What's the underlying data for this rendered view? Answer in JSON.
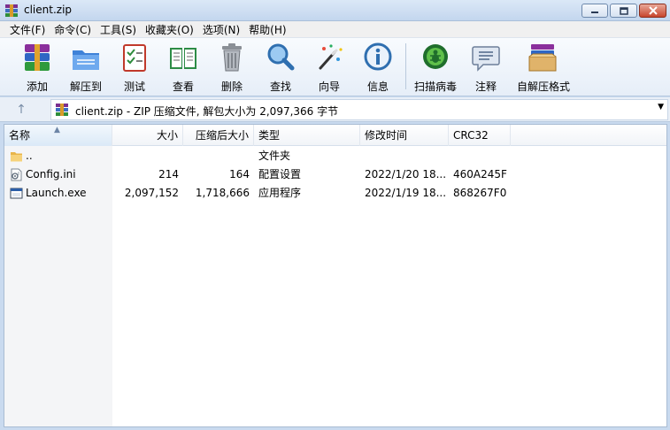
{
  "window": {
    "title": "client.zip"
  },
  "menu": [
    "文件(F)",
    "命令(C)",
    "工具(S)",
    "收藏夹(O)",
    "选项(N)",
    "帮助(H)"
  ],
  "toolbar": {
    "add": "添加",
    "extract_to": "解压到",
    "test": "测试",
    "view": "查看",
    "delete": "删除",
    "find": "查找",
    "wizard": "向导",
    "info": "信息",
    "virus_scan": "扫描病毒",
    "comment": "注释",
    "sfx": "自解压格式"
  },
  "address": {
    "text": "client.zip - ZIP 压缩文件, 解包大小为 2,097,366 字节"
  },
  "columns": {
    "name": "名称",
    "size": "大小",
    "packed": "压缩后大小",
    "type": "类型",
    "modified": "修改时间",
    "crc": "CRC32"
  },
  "files": [
    {
      "name": "..",
      "size": "",
      "packed": "",
      "type": "文件夹",
      "modified": "",
      "crc": "",
      "icon": "folder-icon"
    },
    {
      "name": "Config.ini",
      "size": "214",
      "packed": "164",
      "type": "配置设置",
      "modified": "2022/1/20 18...",
      "crc": "460A245F",
      "icon": "ini-file-icon"
    },
    {
      "name": "Launch.exe",
      "size": "2,097,152",
      "packed": "1,718,666",
      "type": "应用程序",
      "modified": "2022/1/19 18...",
      "crc": "868267F0",
      "icon": "exe-file-icon"
    }
  ],
  "colors": {
    "accent": "#3a6ea5",
    "toolbar_bg": "#eef3fa",
    "title_bg": "#c9daef"
  }
}
